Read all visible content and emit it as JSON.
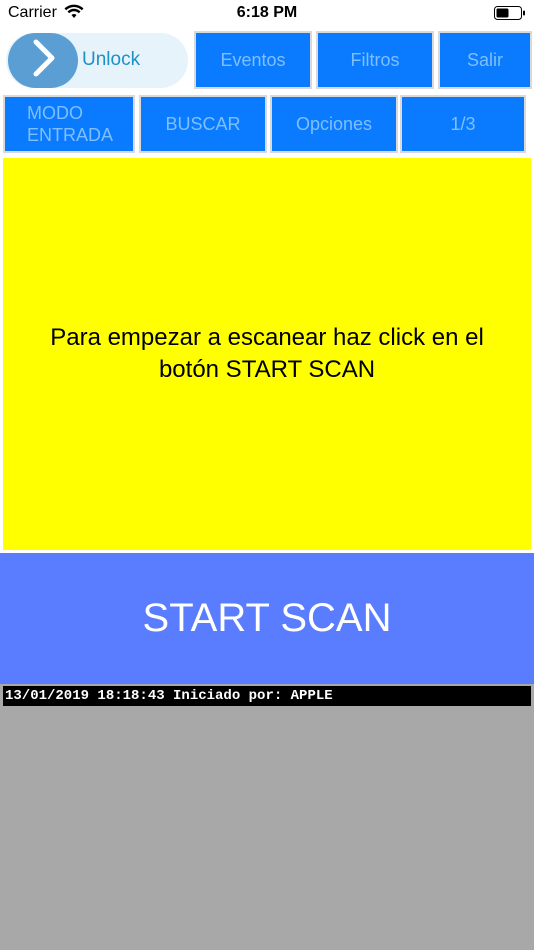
{
  "status_bar": {
    "carrier": "Carrier",
    "time": "6:18 PM",
    "icons": [
      "wifi-icon",
      "battery-icon"
    ]
  },
  "top_row": {
    "unlock_label": "Unlock",
    "eventos_label": "Eventos",
    "filtros_label": "Filtros",
    "salir_label": "Salir"
  },
  "second_row": {
    "modo_label": "MODO ENTRADA",
    "buscar_label": "BUSCAR",
    "opciones_label": "Opciones",
    "page_label": "1/3"
  },
  "panel": {
    "message": "Para empezar a escanear haz click en el botón START SCAN"
  },
  "start_scan": {
    "label": "START SCAN"
  },
  "log": {
    "line": "13/01/2019 18:18:43 Iniciado por: APPLE"
  },
  "colors": {
    "button_bg": "#0a7bff",
    "button_text": "#7fbfff",
    "panel_bg": "#ffff00",
    "start_scan_bg": "#5a7dff",
    "log_area_bg": "#a8a8a8",
    "unlock_pill_bg": "#e6f3fa",
    "unlock_knob_bg": "#5b9ed3"
  }
}
